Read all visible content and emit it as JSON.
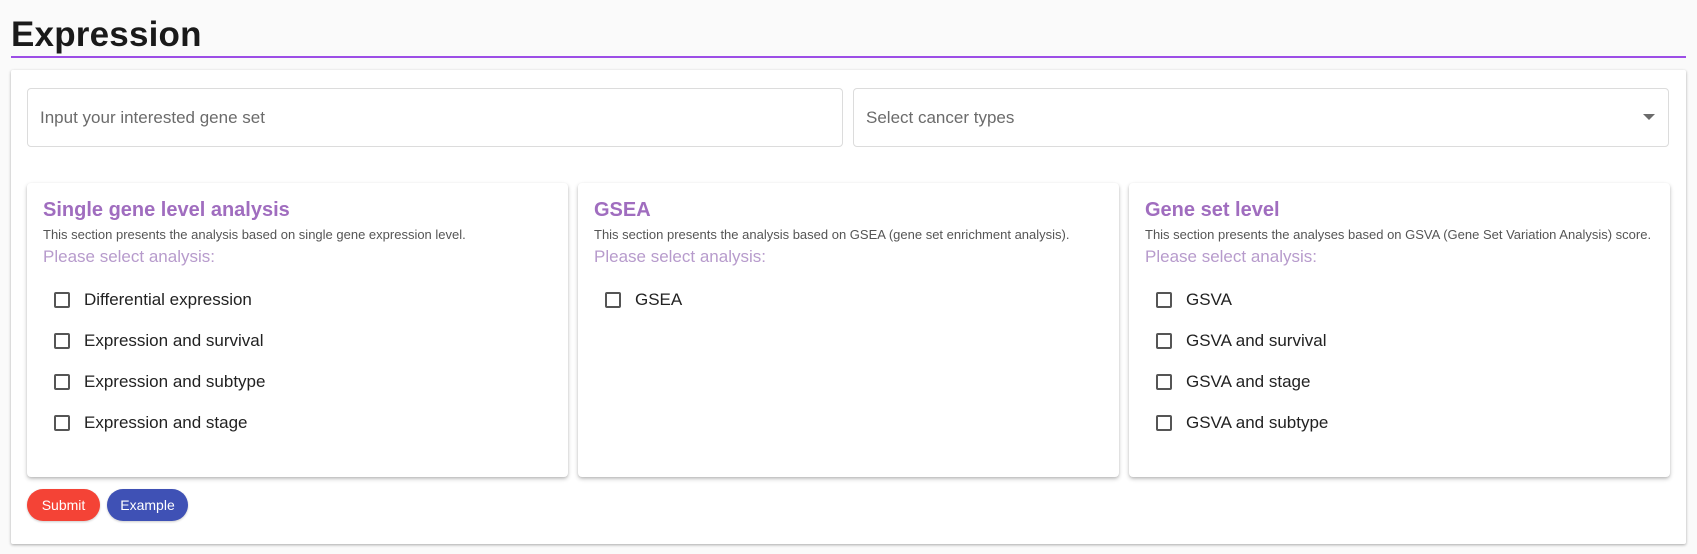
{
  "page": {
    "title": "Expression"
  },
  "form": {
    "gene_input_placeholder": "Input your interested gene set",
    "cancer_select_placeholder": "Select cancer types"
  },
  "panels": [
    {
      "title": "Single gene level analysis",
      "description": "This section presents the analysis based on single gene expression level.",
      "prompt": "Please select analysis:",
      "options": [
        {
          "label": "Differential expression",
          "checked": false
        },
        {
          "label": "Expression and survival",
          "checked": false
        },
        {
          "label": "Expression and subtype",
          "checked": false
        },
        {
          "label": "Expression and stage",
          "checked": false
        }
      ]
    },
    {
      "title": "GSEA",
      "description": "This section presents the analysis based on GSEA (gene set enrichment analysis).",
      "prompt": "Please select analysis:",
      "options": [
        {
          "label": "GSEA",
          "checked": false
        }
      ]
    },
    {
      "title": "Gene set level",
      "description": "This section presents the analyses based on GSVA (Gene Set Variation Analysis) score.",
      "prompt": "Please select analysis:",
      "options": [
        {
          "label": "GSVA",
          "checked": false
        },
        {
          "label": "GSVA and survival",
          "checked": false
        },
        {
          "label": "GSVA and stage",
          "checked": false
        },
        {
          "label": "GSVA and subtype",
          "checked": false
        }
      ]
    }
  ],
  "buttons": {
    "submit_label": "Submit",
    "example_label": "Example"
  },
  "colors": {
    "title_underline": "#9c4ee6",
    "panel_title": "#a06dbf",
    "prompt": "#b79bcc",
    "submit": "#f44336",
    "example": "#3f51b5"
  },
  "icons": {
    "select_caret": "caret-down-icon",
    "checkbox": "checkbox-unchecked-icon"
  }
}
